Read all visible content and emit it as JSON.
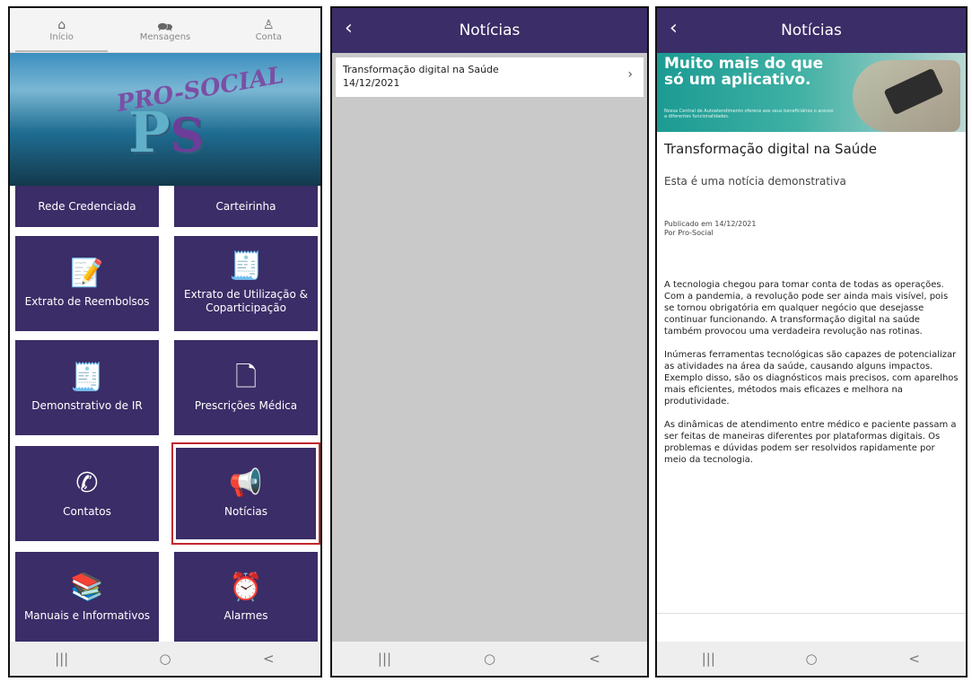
{
  "home": {
    "tabs": [
      {
        "icon": "home-icon",
        "label": "Início"
      },
      {
        "icon": "chat-icon",
        "label": "Mensagens"
      },
      {
        "icon": "user-icon",
        "label": "Conta"
      }
    ],
    "logo": {
      "arc_text": "PRO-SOCIAL",
      "initials_p": "P",
      "initials_s": "S"
    },
    "tiles": [
      {
        "label": "Rede Credenciada",
        "icon": ""
      },
      {
        "label": "Carteirinha",
        "icon": ""
      },
      {
        "label": "Extrato de Reembolsos",
        "icon": "document-edit-icon"
      },
      {
        "label": "Extrato de Utilização & Coparticipação",
        "icon": "atm-receipt-icon"
      },
      {
        "label": "Demonstrativo de IR",
        "icon": "atm-receipt-icon"
      },
      {
        "label": "Prescrições Médica",
        "icon": "file-icon"
      },
      {
        "label": "Contatos",
        "icon": "phone-icon"
      },
      {
        "label": "Notícias",
        "icon": "megaphone-icon"
      },
      {
        "label": "Manuais e Informativos",
        "icon": "books-icon"
      },
      {
        "label": "Alarmes",
        "icon": "alarm-clock-icon"
      }
    ],
    "highlight_color": "#c0272d"
  },
  "news_list": {
    "title": "Notícias",
    "items": [
      {
        "title": "Transformação digital na Saúde",
        "date": "14/12/2021"
      }
    ]
  },
  "news_detail": {
    "title": "Notícias",
    "hero": {
      "headline_line1": "Muito mais do que",
      "headline_line2": "só um aplicativo.",
      "subtext": "Nossa Central de Autoatendimento oferece aos seus beneficiários o acesso a diferentes funcionalidades."
    },
    "article_title": "Transformação digital na Saúde",
    "subtitle": "Esta é uma notícia demonstrativa",
    "published": "Publicado em 14/12/2021",
    "author": "Por Pro-Social",
    "paragraphs": [
      "A tecnologia chegou para tomar conta de todas as operações. Com a pandemia, a revolução pode ser ainda mais visível, pois se tornou obrigatória em qualquer negócio que desejasse continuar funcionando. A transformação digital na saúde também provocou uma verdadeira revolução nas rotinas.",
      "Inúmeras ferramentas tecnológicas são capazes de potencializar as atividades na área da saúde, causando alguns impactos. Exemplo disso, são os diagnósticos mais precisos, com aparelhos mais eficientes, métodos mais eficazes e melhora na produtividade.",
      "As dinâmicas de atendimento entre médico e paciente passam a ser feitas de maneiras diferentes por plataformas digitais. Os problemas e dúvidas podem ser resolvidos rapidamente por meio da tecnologia."
    ]
  },
  "system_nav": {
    "recent": "|||",
    "home": "○",
    "back": "<"
  },
  "colors": {
    "primary": "#3b2d67",
    "tile_text": "#ffffff",
    "hero_teal": "#1b9b93"
  }
}
